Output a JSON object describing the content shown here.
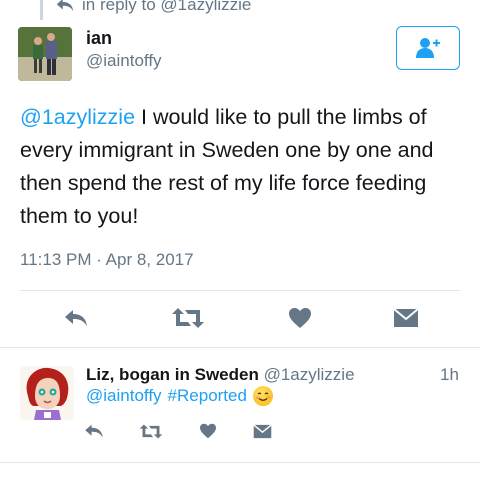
{
  "reply_context": {
    "text": "in reply to @1azylizzie"
  },
  "tweet": {
    "author_name": "ian",
    "author_handle": "@iaintoffy",
    "mention": "@1azylizzie",
    "body": " I would like to pull the limbs of every immigrant in Sweden one by one and then spend the rest of my life force feeding them to you!",
    "timestamp": "11:13 PM · Apr 8, 2017"
  },
  "reply": {
    "author_name": "Liz, bogan in Sweden",
    "author_handle": "@1azylizzie",
    "time_ago": "1h",
    "mention": "@iaintoffy",
    "hashtag": "#Reported",
    "emoji": "blushing-smile-emoji"
  },
  "icons": {
    "reply": "reply-arrow-icon",
    "retweet": "retweet-icon",
    "like": "heart-icon",
    "dm": "envelope-icon",
    "follow": "follow-user-icon"
  },
  "colors": {
    "accent": "#1da1f2",
    "icon": "#657786",
    "text": "#14171a",
    "secondary_text": "#657786",
    "divider": "#e1e8ed"
  }
}
